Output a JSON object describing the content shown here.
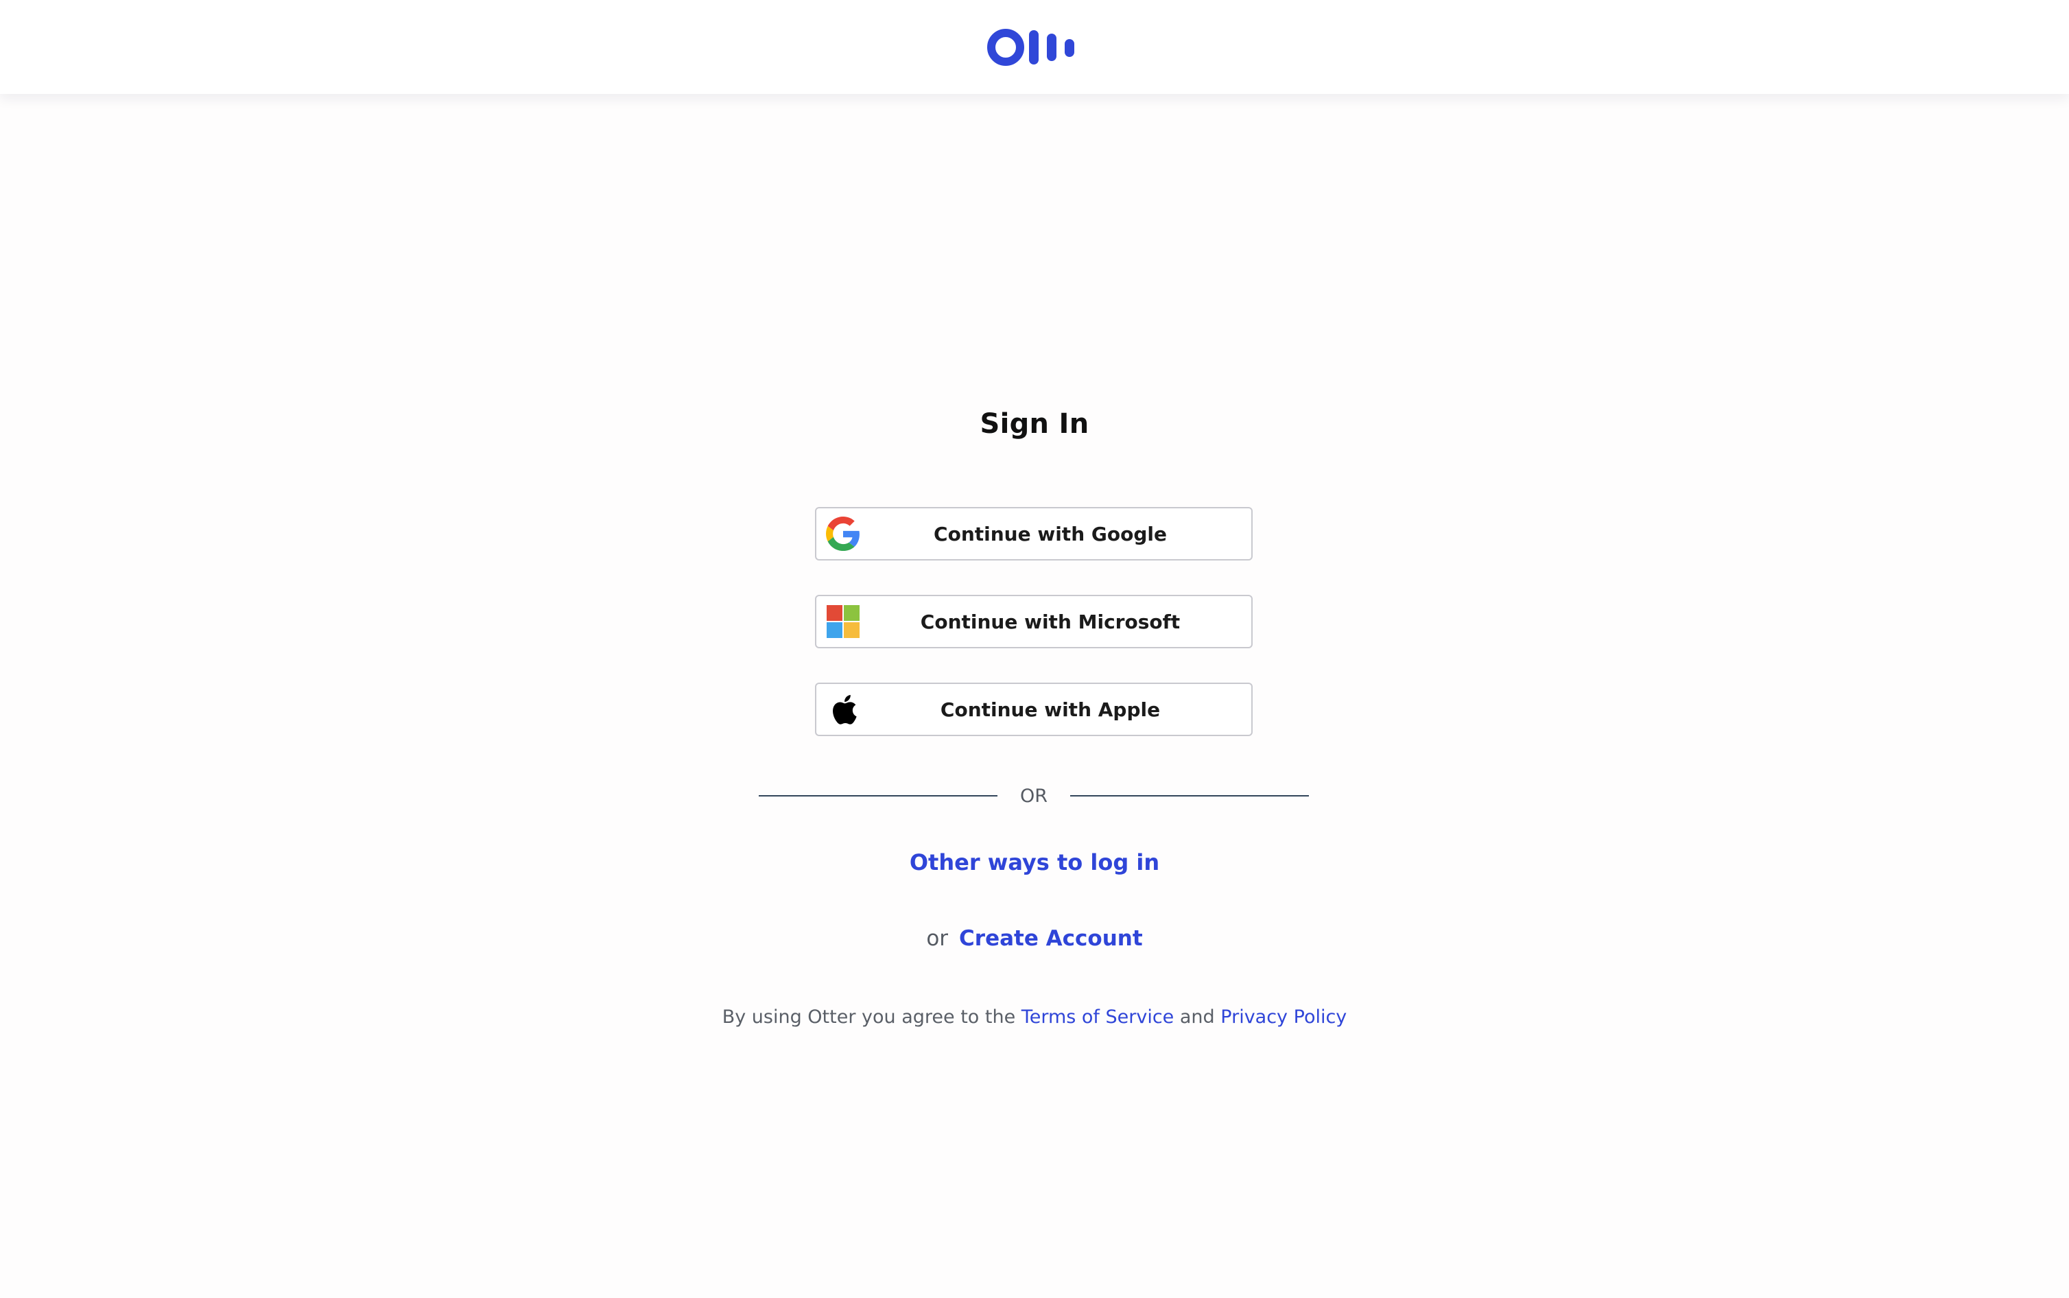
{
  "header": {
    "logo_icon": "otter-logo-icon",
    "brand_color": "#3047d8"
  },
  "signin": {
    "title": "Sign In",
    "buttons": [
      {
        "label": "Continue with Google",
        "icon": "google-icon"
      },
      {
        "label": "Continue with Microsoft",
        "icon": "microsoft-icon"
      },
      {
        "label": "Continue with Apple",
        "icon": "apple-icon"
      }
    ],
    "divider_text": "OR",
    "other_ways": "Other ways to log in",
    "or_small": "or",
    "create_account": "Create Account",
    "terms": {
      "prefix": "By using Otter you agree to the",
      "tos": "Terms of Service",
      "and": "and",
      "privacy": "Privacy Policy"
    }
  },
  "colors": {
    "link": "#2f45d8",
    "button_border": "#c9c9cf",
    "divider": "#33455a"
  }
}
